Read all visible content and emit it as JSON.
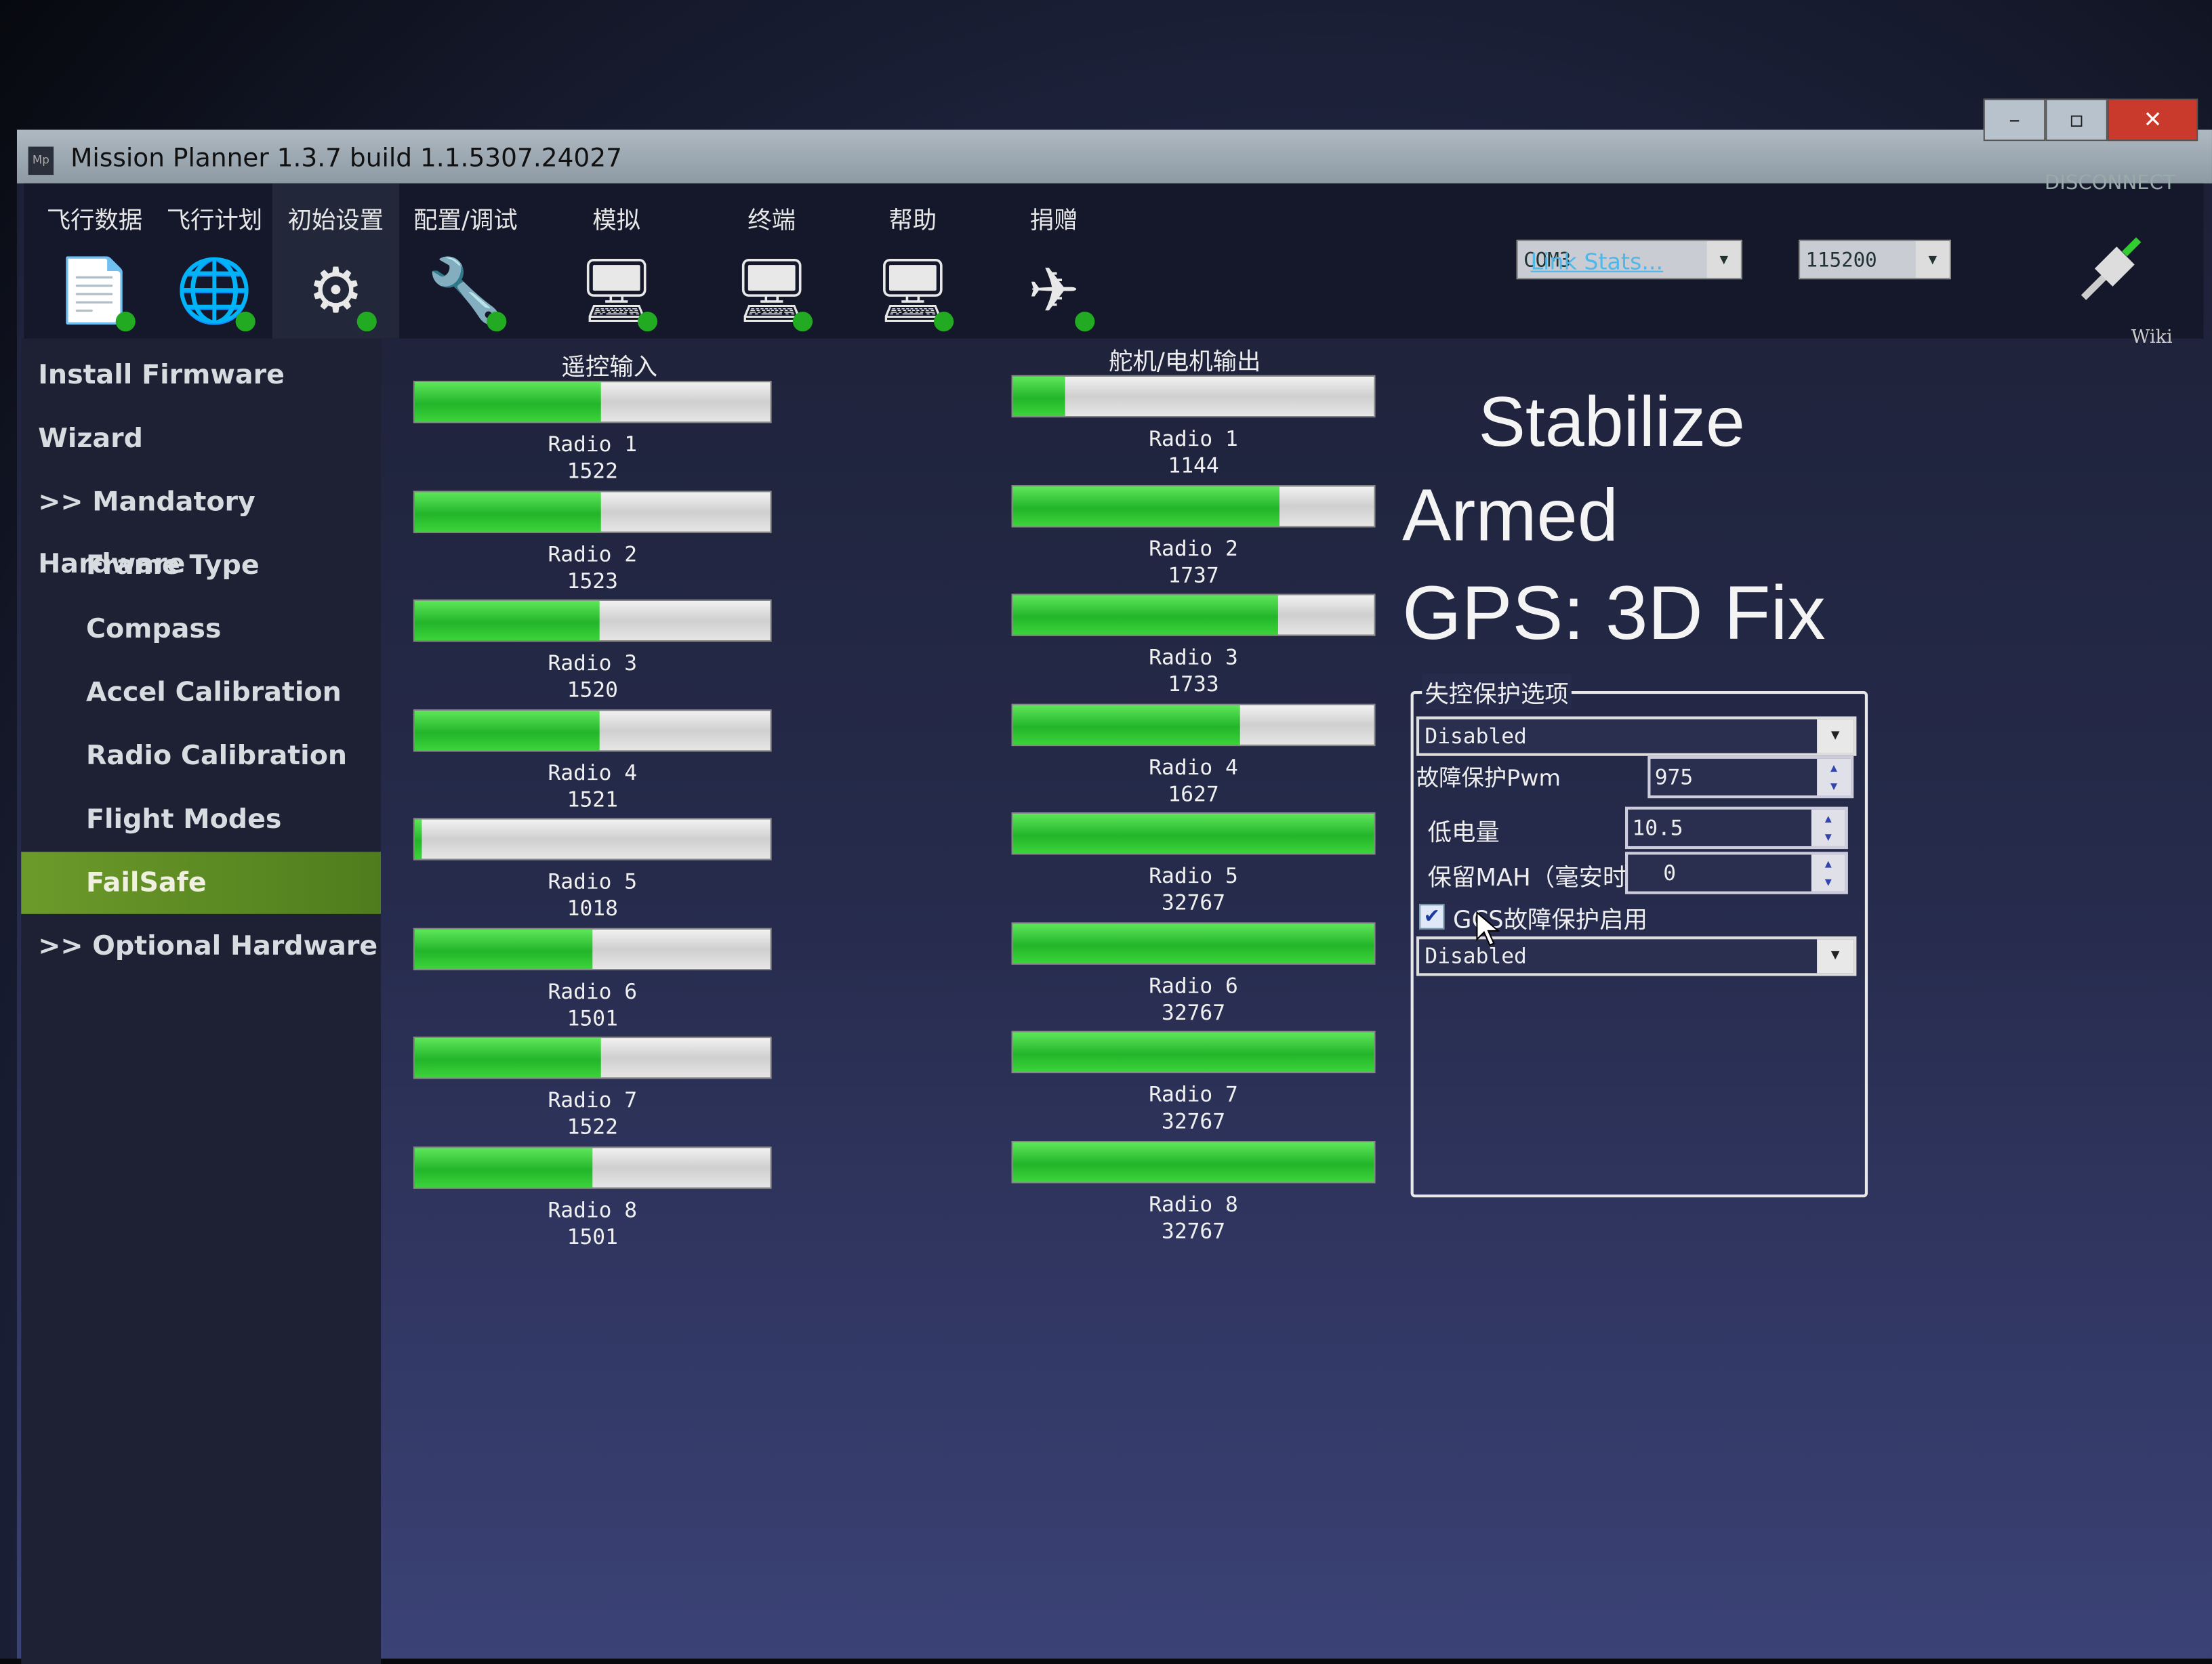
{
  "window": {
    "title": "Mission Planner 1.3.7 build 1.1.5307.24027",
    "logo": "Mp",
    "controls": [
      "minimize",
      "maximize",
      "close"
    ]
  },
  "menu": [
    {
      "label": "飞行数据",
      "icon": "flight-data-icon"
    },
    {
      "label": "飞行计划",
      "icon": "flight-plan-icon"
    },
    {
      "label": "初始设置",
      "icon": "initial-setup-icon",
      "active": true
    },
    {
      "label": "配置/调试",
      "icon": "config-tuning-icon"
    },
    {
      "label": "模拟",
      "icon": "simulation-icon"
    },
    {
      "label": "终端",
      "icon": "terminal-icon"
    },
    {
      "label": "帮助",
      "icon": "help-icon"
    },
    {
      "label": "捐赠",
      "icon": "donate-icon"
    }
  ],
  "connection": {
    "port": "COM3",
    "baud": "115200",
    "link_stats": "Link Stats...",
    "disconnect": "DISCONNECT"
  },
  "wiki": "Wiki",
  "sidebar": [
    {
      "label": "Install Firmware",
      "indent": 0
    },
    {
      "label": "Wizard",
      "indent": 0
    },
    {
      "label": ">> Mandatory Hardware",
      "indent": 0
    },
    {
      "label": "Frame Type",
      "indent": 1
    },
    {
      "label": "Compass",
      "indent": 1
    },
    {
      "label": "Accel Calibration",
      "indent": 1
    },
    {
      "label": "Radio Calibration",
      "indent": 1
    },
    {
      "label": "Flight Modes",
      "indent": 1
    },
    {
      "label": "FailSafe",
      "indent": 1,
      "selected": true
    },
    {
      "label": ">> Optional Hardware",
      "indent": 0
    }
  ],
  "radio_in": {
    "title": "遥控输入",
    "range": [
      1000,
      2000
    ],
    "channels": [
      {
        "name": "Radio 1",
        "value": 1522
      },
      {
        "name": "Radio 2",
        "value": 1523
      },
      {
        "name": "Radio 3",
        "value": 1520
      },
      {
        "name": "Radio 4",
        "value": 1521
      },
      {
        "name": "Radio 5",
        "value": 1018
      },
      {
        "name": "Radio 6",
        "value": 1501
      },
      {
        "name": "Radio 7",
        "value": 1522
      },
      {
        "name": "Radio 8",
        "value": 1501
      }
    ]
  },
  "servo_out": {
    "title": "舵机/电机输出",
    "range": [
      1000,
      2000
    ],
    "channels": [
      {
        "name": "Radio 1",
        "value": 1144
      },
      {
        "name": "Radio 2",
        "value": 1737
      },
      {
        "name": "Radio 3",
        "value": 1733
      },
      {
        "name": "Radio 4",
        "value": 1627
      },
      {
        "name": "Radio 5",
        "value": 32767
      },
      {
        "name": "Radio 6",
        "value": 32767
      },
      {
        "name": "Radio 7",
        "value": 32767
      },
      {
        "name": "Radio 8",
        "value": 32767
      }
    ]
  },
  "status": {
    "mode": "Stabilize",
    "armed": "Armed",
    "gps": "GPS: 3D Fix"
  },
  "failsafe": {
    "title": "失控保护选项",
    "throttle_select": "Disabled",
    "pwm_label": "故障保护Pwm",
    "pwm_value": "975",
    "low_batt_label": "低电量",
    "low_batt_value": "10.5",
    "mah_label": "保留MAH（毫安时）",
    "mah_value": "0",
    "gcs_label": "GCS故障保护启用",
    "gcs_checked": true,
    "battery_select": "Disabled"
  },
  "colors": {
    "bar_fill": "#2fc832",
    "selected_item": "#6c9a2a",
    "close_button": "#c9392c"
  }
}
